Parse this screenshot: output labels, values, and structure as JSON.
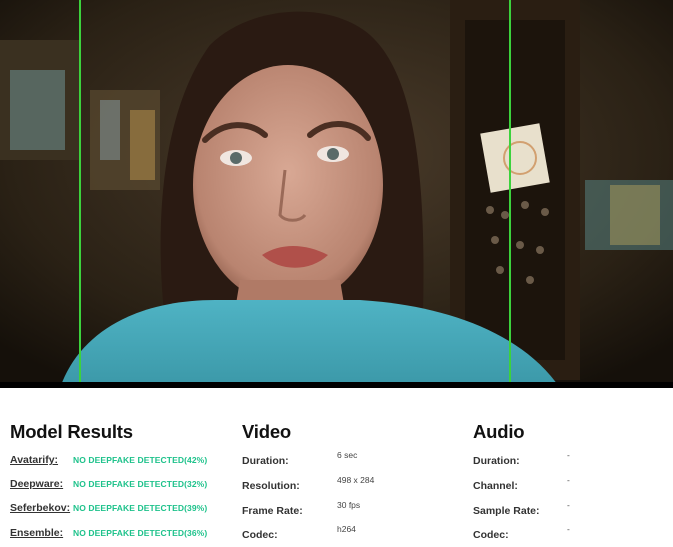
{
  "video_frame": {
    "description_icon": "webcam-frame"
  },
  "model_results": {
    "title": "Model Results",
    "items": [
      {
        "name": "Avatarify:",
        "status": "NO DEEPFAKE DETECTED(42%)"
      },
      {
        "name": "Deepware:",
        "status": "NO DEEPFAKE DETECTED(32%)"
      },
      {
        "name": "Seferbekov:",
        "status": "NO DEEPFAKE DETECTED(39%)"
      },
      {
        "name": "Ensemble:",
        "status": "NO DEEPFAKE DETECTED(36%)"
      }
    ]
  },
  "video": {
    "title": "Video",
    "items": [
      {
        "label": "Duration:",
        "value": "6 sec"
      },
      {
        "label": "Resolution:",
        "value": "498 x 284"
      },
      {
        "label": "Frame Rate:",
        "value": "30 fps"
      },
      {
        "label": "Codec:",
        "value": "h264"
      }
    ]
  },
  "audio": {
    "title": "Audio",
    "items": [
      {
        "label": "Duration:",
        "value": "-"
      },
      {
        "label": "Channel:",
        "value": "-"
      },
      {
        "label": "Sample Rate:",
        "value": "-"
      },
      {
        "label": "Codec:",
        "value": "-"
      }
    ]
  },
  "colors": {
    "status_green": "#1ec28b",
    "guide_line": "#3cd23c"
  }
}
